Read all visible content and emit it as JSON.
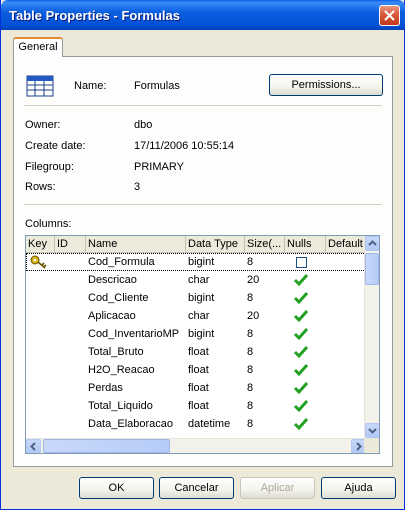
{
  "window": {
    "title": "Table Properties - Formulas"
  },
  "tabs": [
    {
      "label": "General",
      "active": true
    }
  ],
  "properties": {
    "name_label": "Name:",
    "name_value": "Formulas",
    "permissions_button": "Permissions...",
    "owner_label": "Owner:",
    "owner_value": "dbo",
    "create_date_label": "Create date:",
    "create_date_value": "17/11/2006 10:55:14",
    "filegroup_label": "Filegroup:",
    "filegroup_value": "PRIMARY",
    "rows_label": "Rows:",
    "rows_value": "3"
  },
  "columns": {
    "label": "Columns:",
    "headers": [
      "Key",
      "ID",
      "Name",
      "Data Type",
      "Size(...",
      "Nulls",
      "Default"
    ],
    "rows": [
      {
        "key": true,
        "id": "",
        "name": "Cod_Formula",
        "type": "bigint",
        "size": "8",
        "nulls": false
      },
      {
        "key": false,
        "id": "",
        "name": "Descricao",
        "type": "char",
        "size": "20",
        "nulls": true
      },
      {
        "key": false,
        "id": "",
        "name": "Cod_Cliente",
        "type": "bigint",
        "size": "8",
        "nulls": true
      },
      {
        "key": false,
        "id": "",
        "name": "Aplicacao",
        "type": "char",
        "size": "20",
        "nulls": true
      },
      {
        "key": false,
        "id": "",
        "name": "Cod_InventarioMP",
        "type": "bigint",
        "size": "8",
        "nulls": true
      },
      {
        "key": false,
        "id": "",
        "name": "Total_Bruto",
        "type": "float",
        "size": "8",
        "nulls": true
      },
      {
        "key": false,
        "id": "",
        "name": "H2O_Reacao",
        "type": "float",
        "size": "8",
        "nulls": true
      },
      {
        "key": false,
        "id": "",
        "name": "Perdas",
        "type": "float",
        "size": "8",
        "nulls": true
      },
      {
        "key": false,
        "id": "",
        "name": "Total_Liquido",
        "type": "float",
        "size": "8",
        "nulls": true
      },
      {
        "key": false,
        "id": "",
        "name": "Data_Elaboracao",
        "type": "datetime",
        "size": "8",
        "nulls": true
      }
    ]
  },
  "buttons": {
    "ok": "OK",
    "cancel": "Cancelar",
    "apply": "Aplicar",
    "help": "Ajuda"
  },
  "colors": {
    "titlebar": "#0450d6",
    "check": "#21a121",
    "key_icon": "#d8b214"
  }
}
